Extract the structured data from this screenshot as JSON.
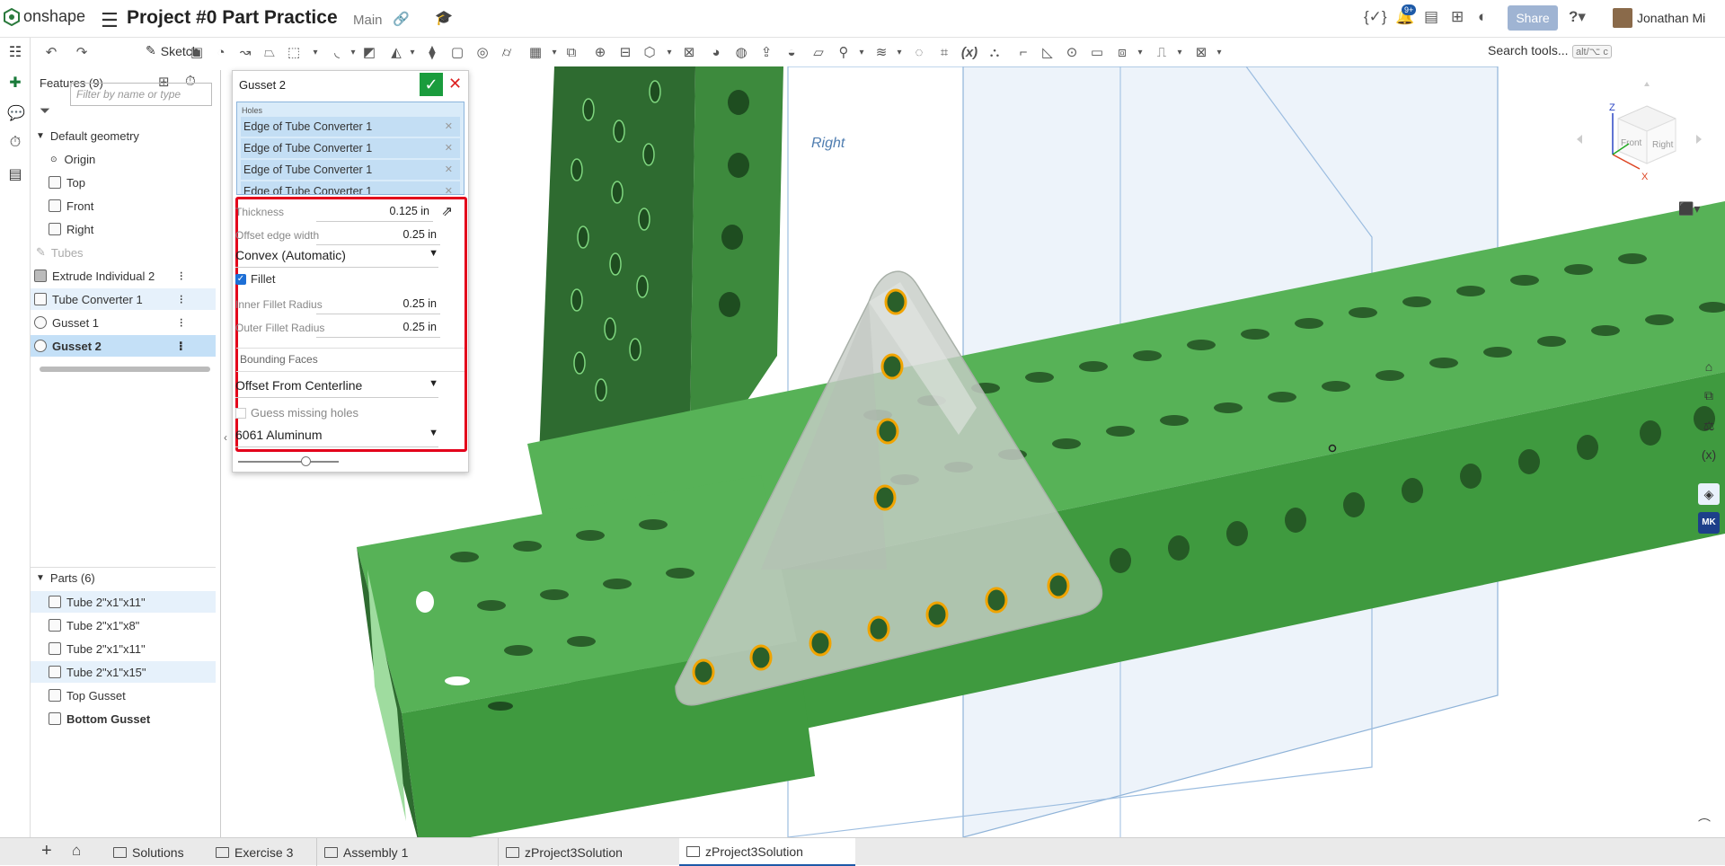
{
  "header": {
    "brand": "onshape",
    "title": "Project #0 Part Practice",
    "branch": "Main",
    "notifications_badge": "9+",
    "share_label": "Share",
    "user_name": "Jonathan Mi",
    "help_label": "?"
  },
  "toolbar": {
    "sketch_label": "Sketch",
    "search_label": "Search tools...",
    "search_shortcut": "alt/⌥ c"
  },
  "features": {
    "header": "Features (9)",
    "filter_placeholder": "Filter by name or type",
    "default_geometry": "Default geometry",
    "geometry_items": [
      "Origin",
      "Top",
      "Front",
      "Right"
    ],
    "tubes_folder": "Tubes",
    "items": [
      {
        "label": "Extrude Individual 2"
      },
      {
        "label": "Tube Converter 1"
      },
      {
        "label": "Gusset 1"
      },
      {
        "label": "Gusset 2"
      }
    ]
  },
  "parts": {
    "header": "Parts (6)",
    "items": [
      "Tube 2\"x1\"x11\"",
      "Tube 2\"x1\"x8\"",
      "Tube 2\"x1\"x11\"",
      "Tube 2\"x1\"x15\"",
      "Top Gusset",
      "Bottom Gusset"
    ]
  },
  "dialog": {
    "title": "Gusset 2",
    "holes_label": "Holes",
    "hole_items": [
      "Edge of Tube Converter 1",
      "Edge of Tube Converter 1",
      "Edge of Tube Converter 1",
      "Edge of Tube Converter 1"
    ],
    "thickness_label": "Thickness",
    "thickness_value": "0.125 in",
    "offset_label": "Offset edge width",
    "offset_value": "0.25 in",
    "convex_option": "Convex (Automatic)",
    "fillet_label": "Fillet",
    "inner_fillet_label": "Inner Fillet Radius",
    "inner_fillet_value": "0.25 in",
    "outer_fillet_label": "Outer Fillet Radius",
    "outer_fillet_value": "0.25 in",
    "bounding_label": "Bounding Faces",
    "bounding_option": "Offset From Centerline",
    "guess_label": "Guess missing holes",
    "material_option": "6061 Aluminum"
  },
  "viewport": {
    "plane_label": "Right",
    "cube_front": "Front",
    "cube_right": "Right",
    "axis_z": "Z",
    "axis_x": "X",
    "colors": {
      "tube_dark": "#2e6b30",
      "tube_mid": "#3f9a3f",
      "tube_light": "#57b257",
      "gusset": "#c7cdc7",
      "hole_ring": "#f0a400",
      "plane": "#b8d1ea"
    }
  },
  "tabs": [
    {
      "label": "Solutions"
    },
    {
      "label": "Exercise 3"
    },
    {
      "label": "Assembly 1"
    },
    {
      "label": "zProject3Solution"
    },
    {
      "label": "zProject3Solution"
    }
  ]
}
